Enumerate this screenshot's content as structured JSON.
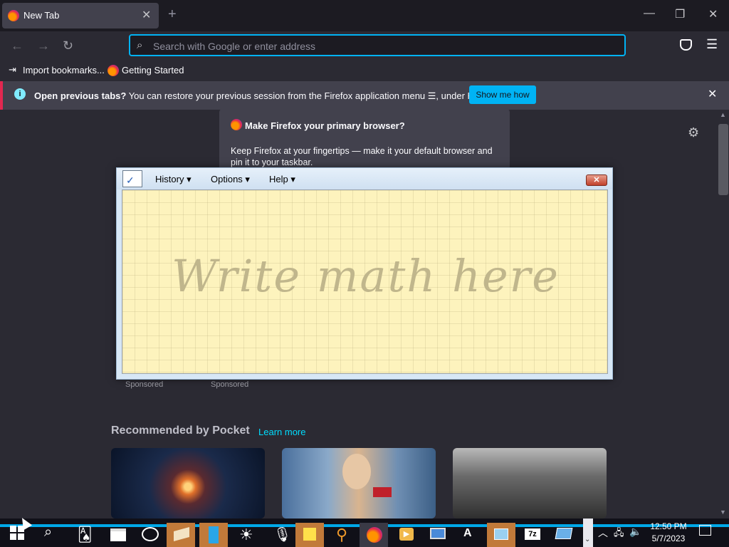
{
  "browser": {
    "tab_title": "New Tab",
    "url_placeholder": "Search with Google or enter address",
    "bookmarks": [
      "Import bookmarks...",
      "Getting Started"
    ],
    "notification": {
      "text_bold": "Open previous tabs?",
      "text": "You can restore your previous session from the Firefox application menu ☰, under History.",
      "button": "Show me how"
    },
    "default_prompt": {
      "title": "Make Firefox your primary browser?",
      "body": "Keep Firefox at your fingertips — make it your default browser and pin it to your taskbar."
    },
    "sponsored": [
      "Sponsored",
      "Sponsored"
    ],
    "pocket": {
      "heading": "Recommended by Pocket",
      "link": "Learn more"
    }
  },
  "math_input": {
    "menus": [
      "History",
      "Options",
      "Help"
    ],
    "hint": "Write math here"
  },
  "taskbar": {
    "time": "12:50 PM",
    "date": "5/7/2023"
  },
  "colors": {
    "accent": "#00b3f4",
    "panel": "#fdf3bd"
  }
}
